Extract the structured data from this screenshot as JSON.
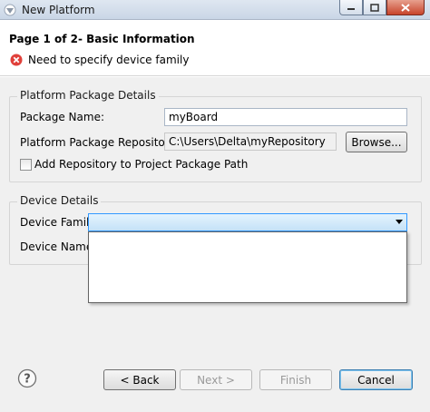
{
  "window": {
    "title": "New Platform",
    "icon": "eclipse-logo-icon"
  },
  "header": {
    "page_title": "Page 1 of 2- Basic Information",
    "error_message": "Need to specify device family",
    "error_icon": "error-x-icon"
  },
  "platform_package_group": {
    "title": "Platform Package Details",
    "package_name_label": "Package Name:",
    "package_name_value": "myBoard",
    "repository_label": "Platform Package Repository:",
    "repository_value": "C:\\Users\\Delta\\myRepository",
    "browse_label": "Browse...",
    "add_repo_label": "Add Repository to Project Package Path",
    "add_repo_checked": false
  },
  "device_group": {
    "title": "Device Details",
    "family_label": "Device Family",
    "family_value": "",
    "name_label": "Device Name"
  },
  "footer": {
    "help_icon": "help-question-icon",
    "back_label": "< Back",
    "next_label": "Next >",
    "finish_label": "Finish",
    "cancel_label": "Cancel"
  },
  "colors": {
    "error_red": "#e0403a",
    "focus_blue": "#3399ff"
  }
}
